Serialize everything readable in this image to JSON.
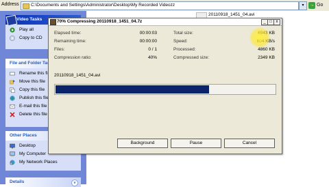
{
  "address_bar": {
    "label": "Address",
    "path": "C:\\Documents and Settings\\Administrator\\Desktop\\My Recorded Videozz",
    "dropdown_glyph": "▾",
    "go_label": "Go",
    "go_glyph": "→"
  },
  "explorer": {
    "file_label": "20110918_1451_04.avi"
  },
  "task_pane": {
    "video_tasks": {
      "title": "Video Tasks",
      "items": [
        {
          "label": "Play all",
          "icon": "play-icon"
        },
        {
          "label": "Copy to CD",
          "icon": "cd-icon"
        }
      ]
    },
    "file_tasks": {
      "title": "File and Folder Tasks",
      "collapse_glyph": "^",
      "items": [
        {
          "label": "Rename this file",
          "icon": "rename-icon"
        },
        {
          "label": "Move this file",
          "icon": "move-icon"
        },
        {
          "label": "Copy this file",
          "icon": "copy-icon"
        },
        {
          "label": "Publish this file",
          "icon": "publish-icon"
        },
        {
          "label": "E-mail this file",
          "icon": "email-icon"
        },
        {
          "label": "Delete this file",
          "icon": "delete-icon"
        }
      ]
    },
    "other_places": {
      "title": "Other Places",
      "items": [
        {
          "label": "Desktop",
          "icon": "desktop-icon"
        },
        {
          "label": "My Computer",
          "icon": "computer-icon"
        },
        {
          "label": "My Network Places",
          "icon": "network-icon"
        }
      ]
    },
    "details": {
      "title": "Details",
      "collapse_glyph": "v"
    }
  },
  "dialog": {
    "title": "70% Compressing 20110918_1451_04.7z",
    "window_buttons": {
      "minimize": "_",
      "maximize": "□",
      "close": "x"
    },
    "stats_left": [
      {
        "label": "Elapsed time:",
        "value": "00:00:03"
      },
      {
        "label": "Remaining time:",
        "value": "00:00:00"
      },
      {
        "label": "Files:",
        "value": "0 / 1"
      },
      {
        "label": "Compression ratio:",
        "value": "40%"
      }
    ],
    "stats_right": [
      {
        "label": "Total size:",
        "value": "6943 KB"
      },
      {
        "label": "Speed:",
        "value": "604 KB/s"
      },
      {
        "label": "Processed:",
        "value": "4860 KB"
      },
      {
        "label": "Compressed size:",
        "value": "2349 KB"
      }
    ],
    "current_file": "20110918_1451_04.avi",
    "progress": 0.7,
    "buttons": {
      "background": "Background",
      "pause": "Pause",
      "cancel": "Cancel"
    }
  },
  "colors": {
    "task_pane_bg": "#6f87d6",
    "progress_fill": "#0a246a",
    "dialog_bg": "#ece9d8"
  }
}
